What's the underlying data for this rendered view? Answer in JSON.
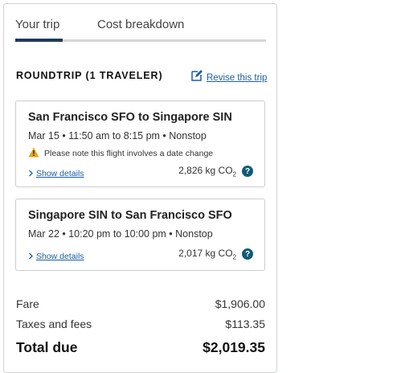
{
  "tabs": [
    {
      "label": "Your trip",
      "active": true
    },
    {
      "label": "Cost breakdown",
      "active": false
    }
  ],
  "trip": {
    "heading": "ROUNDTRIP (1 TRAVELER)",
    "revise_label": "Revise this trip"
  },
  "flights": [
    {
      "route": "San Francisco SFO to Singapore SIN",
      "times": "Mar 15 • 11:50 am to 8:15 pm • Nonstop",
      "warning": "Please note this flight involves a date change",
      "show_details": "Show details",
      "co2_value": "2,826 kg CO",
      "co2_sub": "2",
      "help": "?"
    },
    {
      "route": "Singapore SIN to San Francisco SFO",
      "times": "Mar 22 • 10:20 pm to 10:00 pm • Nonstop",
      "show_details": "Show details",
      "co2_value": "2,017 kg CO",
      "co2_sub": "2",
      "help": "?"
    }
  ],
  "costs": {
    "fare_label": "Fare",
    "fare_value": "$1,906.00",
    "taxes_label": "Taxes and fees",
    "taxes_value": "$113.35",
    "total_label": "Total due",
    "total_value": "$2,019.35"
  },
  "colors": {
    "link": "#1d5fa4",
    "tab_active": "#1f3b5c",
    "help_button": "#0f5c74",
    "warning": "#e8a317"
  },
  "icons": {
    "revise": "edit-icon",
    "warning": "warning-icon",
    "show_details": "chevron-right-icon",
    "help": "question-icon"
  }
}
